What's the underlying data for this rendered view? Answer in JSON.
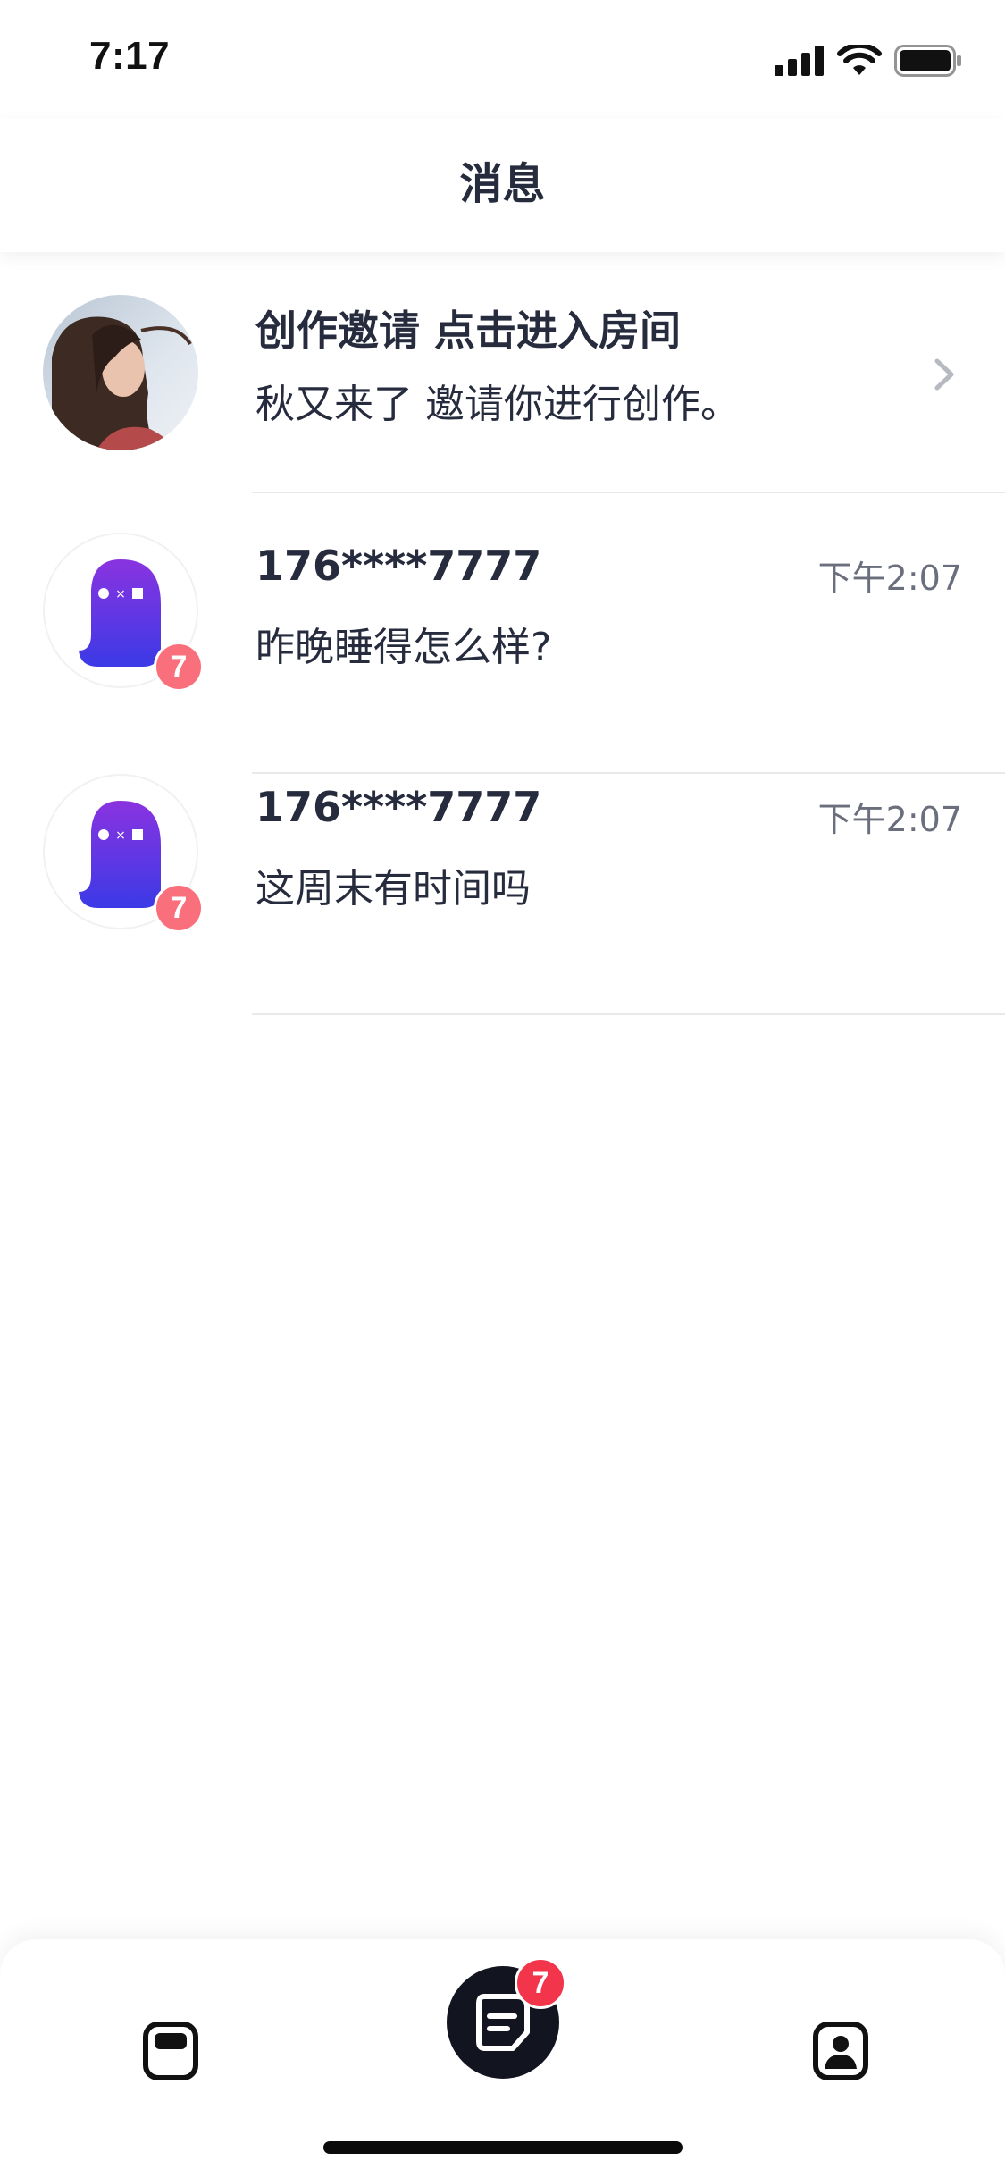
{
  "status_bar": {
    "time": "7:17",
    "icons": [
      "signal-icon",
      "wifi-icon",
      "battery-icon"
    ]
  },
  "header": {
    "title": "消息"
  },
  "messages": [
    {
      "type": "invite",
      "title": "创作邀请 点击进入房间",
      "subtitle": "秋又来了 邀请你进行创作。",
      "icon": "chevron-right-icon"
    },
    {
      "type": "chat",
      "name": "176****7777",
      "preview": "昨晚睡得怎么样?",
      "time": "下午2:07",
      "unread": "7"
    },
    {
      "type": "chat",
      "name": "176****7777",
      "preview": "这周末有时间吗",
      "time": "下午2:07",
      "unread": "7"
    }
  ],
  "tabbar": {
    "tabs": [
      {
        "icon": "home-card-icon"
      },
      {
        "icon": "message-icon",
        "badge": "7"
      },
      {
        "icon": "profile-icon"
      }
    ]
  },
  "colors": {
    "text_primary": "#262b3d",
    "text_secondary": "#6b6f7d",
    "badge_avatar": "#fa6f7c",
    "badge_tab": "#f2354b",
    "ghost_gradient_top": "#8a33e0",
    "ghost_gradient_bottom": "#3b3ae6",
    "tab_active_bg": "#121420"
  }
}
